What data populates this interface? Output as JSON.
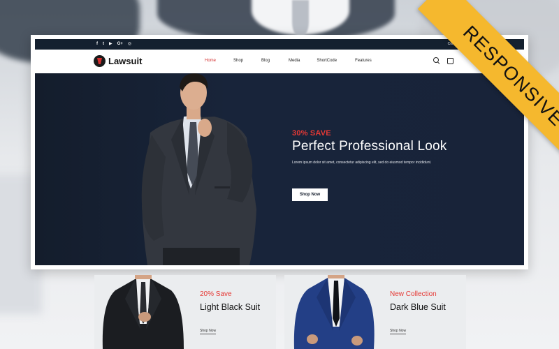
{
  "topbar": {
    "social_icons": [
      "facebook-icon",
      "twitter-icon",
      "youtube-icon",
      "google-plus-icon",
      "instagram-icon"
    ],
    "social_glyphs": [
      "f",
      "t",
      "▶",
      "G+",
      "◎"
    ],
    "contact": "Conta"
  },
  "brand": {
    "name": "Lawsuit"
  },
  "nav": {
    "items": [
      "Home",
      "Shop",
      "Blog",
      "Media",
      "ShortCode",
      "Features"
    ],
    "active": "Home"
  },
  "hero": {
    "tag": "30% SAVE",
    "title": "Perfect Professional Look",
    "subtitle": "Lorem ipsum dolor sit amet, consectetur adipiscing elit, sed do eiusmod tempor incididunt.",
    "button": "Shop Now"
  },
  "promos": [
    {
      "tag": "20% Save",
      "title": "Light Black Suit",
      "link": "Shop Now"
    },
    {
      "tag": "New Collection",
      "title": "Dark Blue Suit",
      "link": "Shop Now"
    }
  ],
  "ribbon": {
    "label": "RESPONSIVE"
  },
  "colors": {
    "accent": "#e53935",
    "hero_bg": "#18243a",
    "ribbon": "#f5b82e",
    "topbar": "#14202f"
  }
}
